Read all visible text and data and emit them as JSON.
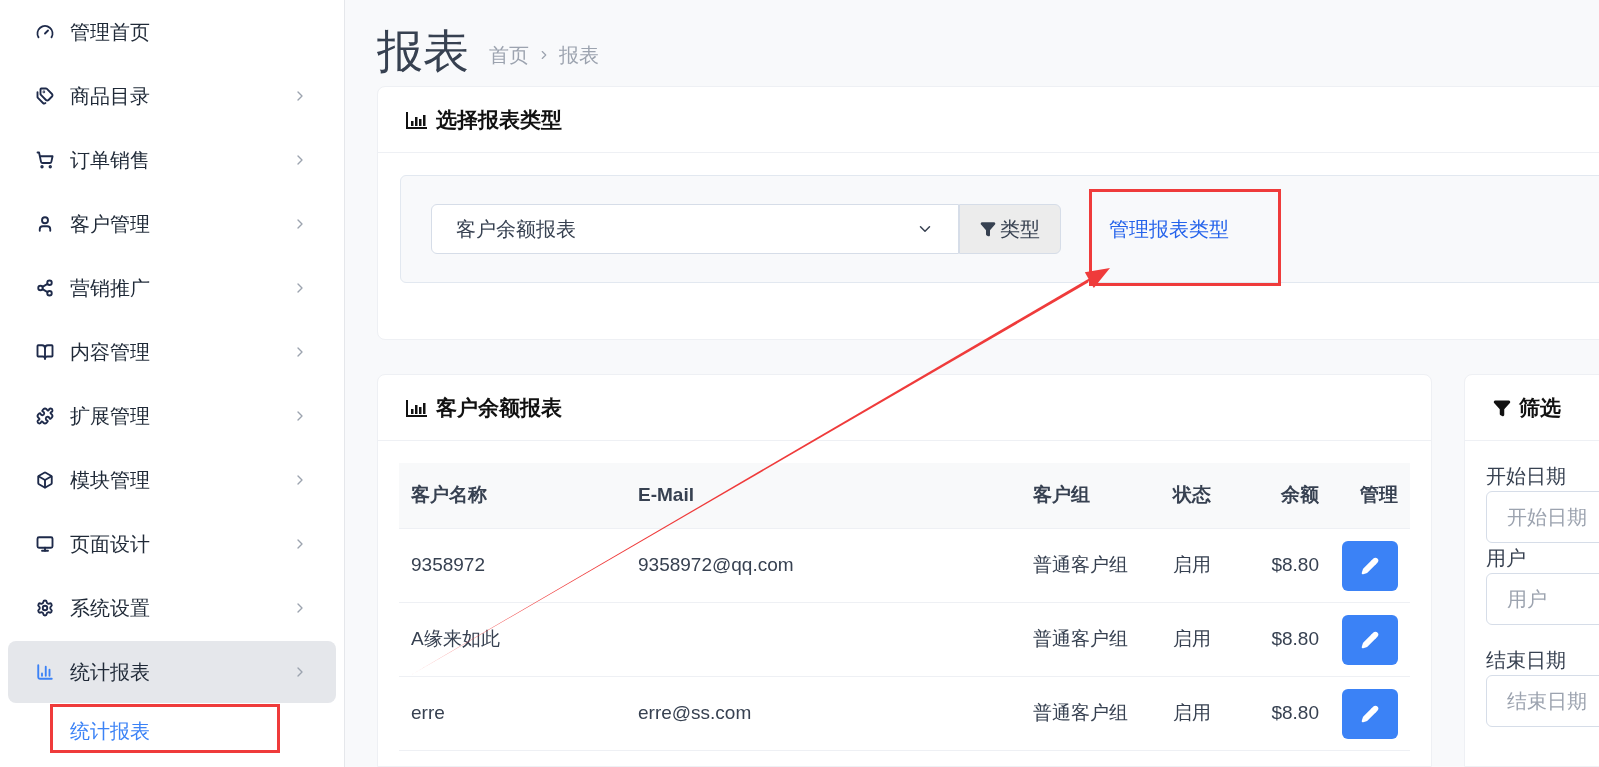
{
  "sidebar": {
    "items": [
      {
        "label": "管理首页",
        "kind": "dashboard",
        "expandable": false,
        "selected": false
      },
      {
        "label": "商品目录",
        "kind": "tags",
        "expandable": true,
        "selected": false
      },
      {
        "label": "订单销售",
        "kind": "cart",
        "expandable": true,
        "selected": false
      },
      {
        "label": "客户管理",
        "kind": "user",
        "expandable": true,
        "selected": false
      },
      {
        "label": "营销推广",
        "kind": "share",
        "expandable": true,
        "selected": false
      },
      {
        "label": "内容管理",
        "kind": "book",
        "expandable": true,
        "selected": false
      },
      {
        "label": "扩展管理",
        "kind": "puzzle",
        "expandable": true,
        "selected": false
      },
      {
        "label": "模块管理",
        "kind": "cube",
        "expandable": true,
        "selected": false
      },
      {
        "label": "页面设计",
        "kind": "desktop",
        "expandable": true,
        "selected": false
      },
      {
        "label": "系统设置",
        "kind": "gear",
        "expandable": true,
        "selected": false
      },
      {
        "label": "统计报表",
        "kind": "chart",
        "expandable": true,
        "selected": true,
        "children": [
          {
            "label": "统计报表",
            "selected": true
          }
        ]
      }
    ]
  },
  "page": {
    "title": "报表",
    "breadcrumb": [
      "首页",
      "报表"
    ]
  },
  "report_type_card": {
    "title": "选择报表类型",
    "select": {
      "value": "客户余额报表"
    },
    "type_button": "类型",
    "manage_link": "管理报表类型"
  },
  "report_card": {
    "title": "客户余额报表",
    "table": {
      "columns": [
        "客户名称",
        "E-Mail",
        "客户组",
        "状态",
        "余额",
        "管理"
      ],
      "rows": [
        {
          "name": "9358972",
          "email": "9358972@qq.com",
          "group": "普通客户组",
          "status": "启用",
          "balance": "$8.80"
        },
        {
          "name": "A缘来如此",
          "group": "普通客户组",
          "status": "启用",
          "balance": "$8.80"
        },
        {
          "name": "erre",
          "email": "erre@ss.com",
          "group": "普通客户组",
          "status": "启用",
          "balance": "$8.80"
        }
      ]
    }
  },
  "filter": {
    "title": "筛选",
    "fields": [
      {
        "label": "开始日期",
        "placeholder": "开始日期"
      },
      {
        "label": "用户",
        "placeholder": "用户"
      },
      {
        "label": "结束日期",
        "placeholder": "结束日期"
      }
    ]
  }
}
